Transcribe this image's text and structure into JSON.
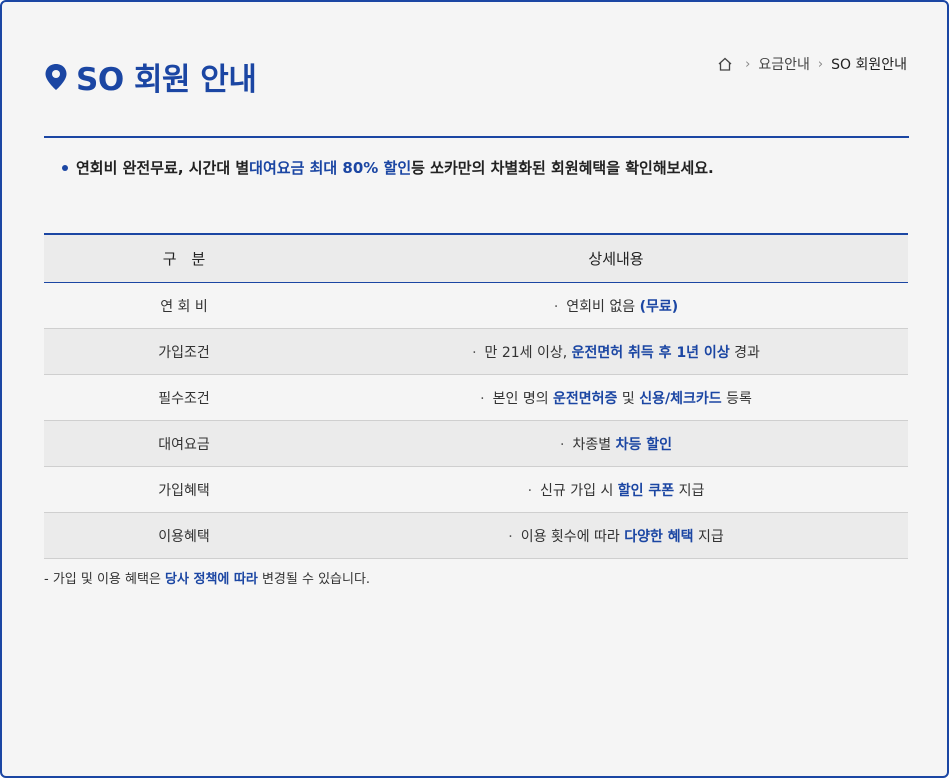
{
  "header": {
    "title": "SO 회원 안내",
    "icon": "location-pin-icon",
    "accent_color": "#1b46a3"
  },
  "breadcrumb": {
    "home_icon": "home-icon",
    "items": [
      "요금안내",
      "SO 회원안내"
    ]
  },
  "notice": {
    "text_before": "연회비 완전무료, 시간대 별 ",
    "highlight": "대여요금 최대 80% 할인",
    "text_after": " 등 쏘카만의 차별화된 회원혜택을 확인해보세요."
  },
  "table": {
    "headers": [
      "구　분",
      "상세내용"
    ],
    "rows": [
      {
        "label": "연 회 비",
        "before": "연회비 없음 ",
        "highlight": "(무료)",
        "after": ""
      },
      {
        "label": "가입조건",
        "before": "만 21세 이상, ",
        "highlight": "운전면허 취득 후 1년 이상",
        "after": " 경과"
      },
      {
        "label": "필수조건",
        "before": "본인 명의 ",
        "highlight": "운전면허증",
        "mid": " 및 ",
        "highlight2": "신용/체크카드",
        "after": " 등록"
      },
      {
        "label": "대여요금",
        "before": "차종별 ",
        "highlight": "차등 할인",
        "after": ""
      },
      {
        "label": "가입혜택",
        "before": "신규 가입 시 ",
        "highlight": "할인 쿠폰",
        "after": " 지급"
      },
      {
        "label": "이용혜택",
        "before": "이용 횟수에 따라 ",
        "highlight": "다양한 혜택",
        "after": " 지급"
      }
    ]
  },
  "footnote": {
    "before": "- 가입 및 이용 혜택은 ",
    "highlight": "당사 정책에 따라",
    "after": " 변경될 수 있습니다."
  }
}
